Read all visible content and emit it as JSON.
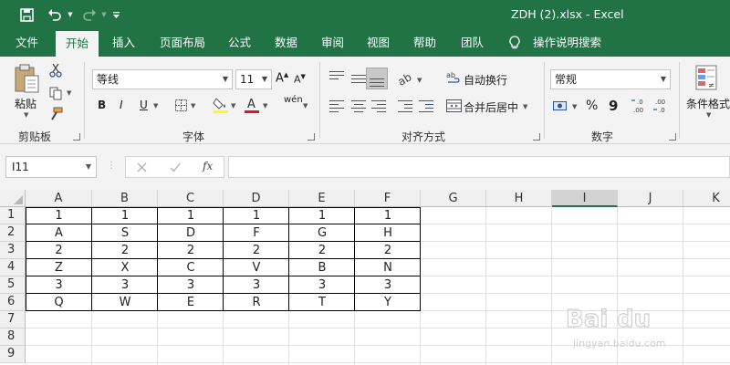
{
  "titlebar": {
    "title": "ZDH (2).xlsx  -  Excel",
    "icons": [
      "save-icon",
      "undo-icon",
      "redo-icon",
      "customize-quick-access-icon"
    ]
  },
  "tabs": [
    "文件",
    "开始",
    "插入",
    "页面布局",
    "公式",
    "数据",
    "审阅",
    "视图",
    "帮助",
    "团队"
  ],
  "tell_me": "操作说明搜索",
  "active_tab": "开始",
  "ribbon": {
    "clipboard": {
      "paste": "粘贴",
      "group": "剪贴板"
    },
    "font": {
      "name": "等线",
      "size": "11",
      "bold": "B",
      "italic": "I",
      "underline": "U",
      "phonetic": "wén",
      "group": "字体"
    },
    "alignment": {
      "wrap": "自动换行",
      "merge": "合并后居中",
      "group": "对齐方式"
    },
    "number": {
      "format": "常规",
      "percent": "%",
      "comma": "9",
      "group": "数字"
    },
    "styles": {
      "conditional": "条件格式"
    }
  },
  "formula_bar": {
    "name_box": "I11",
    "fx": "fx",
    "formula": ""
  },
  "sheet": {
    "columns": [
      "A",
      "B",
      "C",
      "D",
      "E",
      "F",
      "G",
      "H",
      "I",
      "J",
      "K"
    ],
    "selected_column": "I",
    "rows": [
      "1",
      "2",
      "3",
      "4",
      "5",
      "6",
      "7",
      "8",
      "9"
    ],
    "data": [
      [
        "1",
        "1",
        "1",
        "1",
        "1",
        "1"
      ],
      [
        "A",
        "S",
        "D",
        "F",
        "G",
        "H"
      ],
      [
        "2",
        "2",
        "2",
        "2",
        "2",
        "2"
      ],
      [
        "Z",
        "X",
        "C",
        "V",
        "B",
        "N"
      ],
      [
        "3",
        "3",
        "3",
        "3",
        "3",
        "3"
      ],
      [
        "Q",
        "W",
        "E",
        "R",
        "T",
        "Y"
      ]
    ]
  },
  "colors": {
    "accent": "#217346",
    "font_color_bar": "#e81123",
    "fill_color_bar": "#ffff00"
  }
}
